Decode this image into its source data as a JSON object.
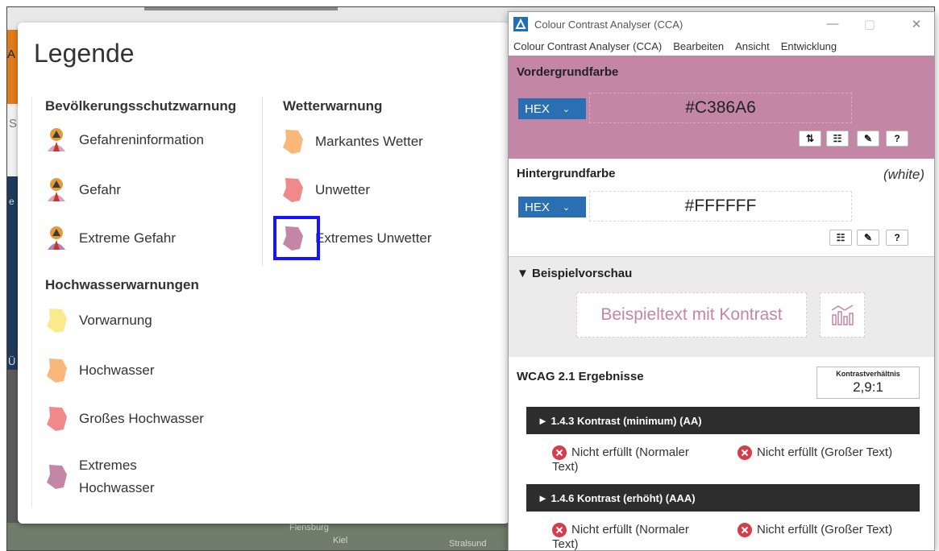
{
  "background": {
    "map_labels": [
      "Flensburg",
      "Kiel",
      "Stralsund"
    ],
    "side_letters": [
      "A",
      "S",
      "e",
      "Ü"
    ]
  },
  "legend": {
    "title": "Legende",
    "sections": [
      {
        "title": "Bevölkerungsschutzwarnung",
        "items": [
          {
            "label": "Gefahreninformation",
            "icon": "person-warning-icon"
          },
          {
            "label": "Gefahr",
            "icon": "person-warning-icon"
          },
          {
            "label": "Extreme Gefahr",
            "icon": "person-warning-icon"
          }
        ]
      },
      {
        "title": "Wetterwarnung",
        "items": [
          {
            "label": "Markantes Wetter",
            "icon": "region-orange-icon",
            "color": "#f9b87a"
          },
          {
            "label": "Unwetter",
            "icon": "region-red-icon",
            "color": "#f08a8a"
          },
          {
            "label": "Extremes Unwetter",
            "icon": "region-purple-icon",
            "color": "#c386a6"
          }
        ]
      },
      {
        "title": "Hochwasserwarnungen",
        "items": [
          {
            "label": "Vorwarnung",
            "icon": "region-yellow-icon",
            "color": "#fbea8c"
          },
          {
            "label": "Hochwasser",
            "icon": "region-orange-icon",
            "color": "#f9b87a"
          },
          {
            "label": "Großes Hochwasser",
            "icon": "region-red-icon",
            "color": "#f08a8a"
          },
          {
            "label_line1": "Extremes",
            "label_line2": "Hochwasser",
            "icon": "region-purple-icon",
            "color": "#c386a6"
          }
        ]
      }
    ]
  },
  "cca": {
    "window_title": "Colour Contrast Analyser (CCA)",
    "menu": [
      "Colour Contrast Analyser (CCA)",
      "Bearbeiten",
      "Ansicht",
      "Entwicklung"
    ],
    "foreground": {
      "label": "Vordergrundfarbe",
      "format": "HEX",
      "value": "#C386A6",
      "color": "#c386a6"
    },
    "background": {
      "label": "Hintergrundfarbe",
      "format": "HEX",
      "value": "#FFFFFF",
      "name": "(white)"
    },
    "preview": {
      "label": "▼ Beispielvorschau",
      "sample_text": "Beispieltext mit Kontrast"
    },
    "wcag": {
      "label": "WCAG 2.1 Ergebnisse",
      "ratio_label": "Kontrastverhältnis",
      "ratio_value": "2,9:1",
      "criteria": [
        {
          "title": "► 1.4.3 Kontrast (minimum) (AA)",
          "normal_line1": "Nicht erfüllt (Normaler",
          "normal_line2": "Text)",
          "large": "Nicht erfüllt (Großer Text)"
        },
        {
          "title": "► 1.4.6 Kontrast (erhöht) (AAA)",
          "normal_line1": "Nicht erfüllt (Normaler",
          "normal_line2": "Text)",
          "large": "Nicht erfüllt (Großer Text)"
        }
      ]
    }
  }
}
